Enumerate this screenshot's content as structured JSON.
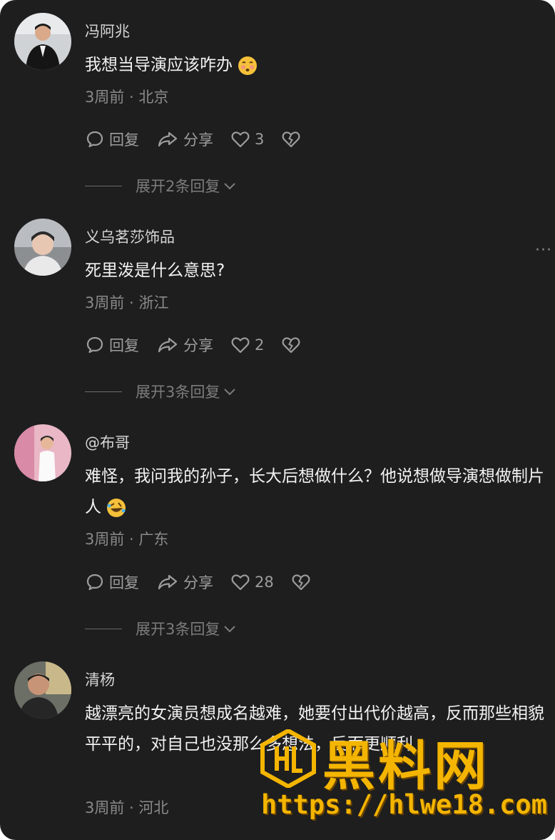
{
  "comments": [
    {
      "username": "冯阿兆",
      "text": "我想当导演应该咋办",
      "emoji": "face-exhaling-emoji",
      "meta": "3周前 · 北京",
      "reply_label": "回复",
      "share_label": "分享",
      "likes": "3",
      "expand_label": "展开2条回复"
    },
    {
      "username": "义乌茗莎饰品",
      "text": "死里泼是什么意思?",
      "meta": "3周前 · 浙江",
      "reply_label": "回复",
      "share_label": "分享",
      "likes": "2",
      "expand_label": "展开3条回复",
      "more_label": "···"
    },
    {
      "username": "@布哥",
      "text": "难怪，我问我的孙子，长大后想做什么？他说想做导演想做制片人",
      "emoji": "rolling-laughing-emoji",
      "meta": "3周前 · 广东",
      "reply_label": "回复",
      "share_label": "分享",
      "likes": "28",
      "expand_label": "展开3条回复"
    },
    {
      "username": "清杨",
      "text": "越漂亮的女演员想成名越难，她要付出代价越高，反而那些相貌平平的，对自己也没那么多想法，反而更顺利",
      "meta": "3周前 · 河北"
    }
  ],
  "watermark": {
    "title": "黑料网",
    "url": "https://hlwe18.com",
    "color": "#f4b500"
  },
  "colors": {
    "background": "#1e1e1f",
    "text": "#f2f2f2",
    "secondary": "#8a8a8a"
  }
}
